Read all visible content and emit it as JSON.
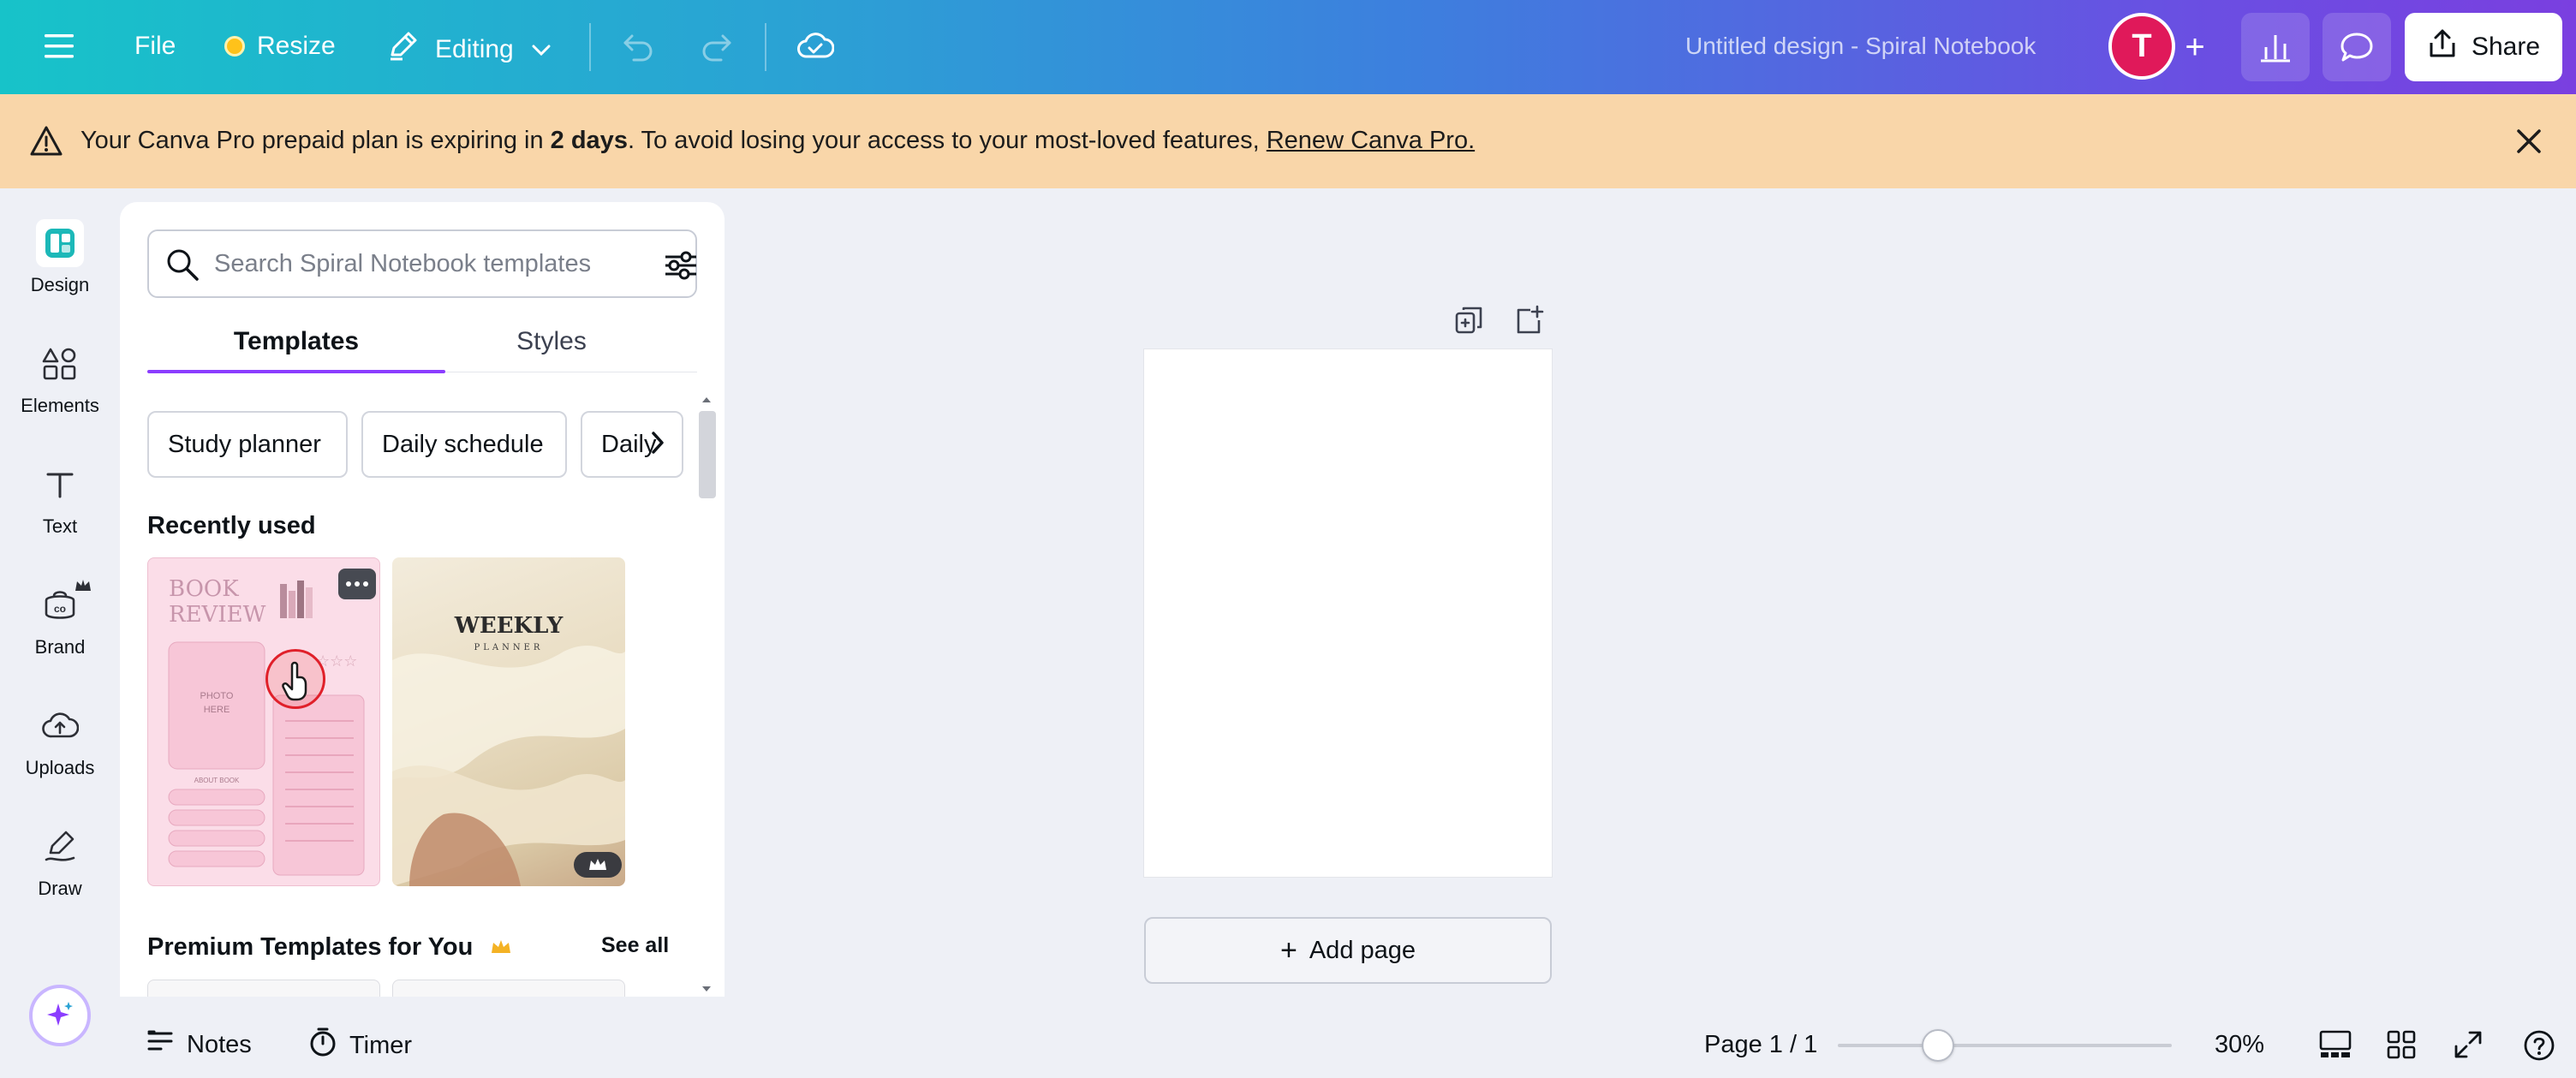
{
  "topbar": {
    "file_label": "File",
    "resize_label": "Resize",
    "editing_label": "Editing",
    "doc_title": "Untitled design - Spiral Notebook",
    "avatar_initial": "T",
    "add_label": "+",
    "share_label": "Share"
  },
  "banner": {
    "text_before": "Your Canva Pro prepaid plan is expiring in ",
    "days": "2 days",
    "text_after": ". To avoid losing your access to your most-loved features, ",
    "link": "Renew Canva Pro."
  },
  "rail": {
    "items": [
      {
        "label": "Design"
      },
      {
        "label": "Elements"
      },
      {
        "label": "Text"
      },
      {
        "label": "Brand"
      },
      {
        "label": "Uploads"
      },
      {
        "label": "Draw"
      }
    ]
  },
  "panel": {
    "search_placeholder": "Search Spiral Notebook templates",
    "tabs": [
      "Templates",
      "Styles"
    ],
    "chips": [
      "Study planner",
      "Daily schedule",
      "Daily"
    ],
    "recently_used": "Recently used",
    "premium_title": "Premium Templates for You",
    "see_all": "See all",
    "thumb_book": {
      "title_1": "BOOK",
      "title_2": "REVIEW",
      "photo_1": "PHOTO",
      "photo_2": "HERE",
      "about": "ABOUT BOOK"
    },
    "thumb_weekly": {
      "title": "WEEKLY",
      "sub": "PLANNER"
    }
  },
  "canvas": {
    "add_page": "Add page"
  },
  "bottombar": {
    "notes": "Notes",
    "timer": "Timer",
    "page_indicator": "Page 1 / 1",
    "zoom": "30%",
    "zoom_fraction": 0.3
  },
  "colors": {
    "accent": "#8b3dff",
    "avatar": "#e0195a",
    "banner_bg": "#f9d6a9"
  }
}
